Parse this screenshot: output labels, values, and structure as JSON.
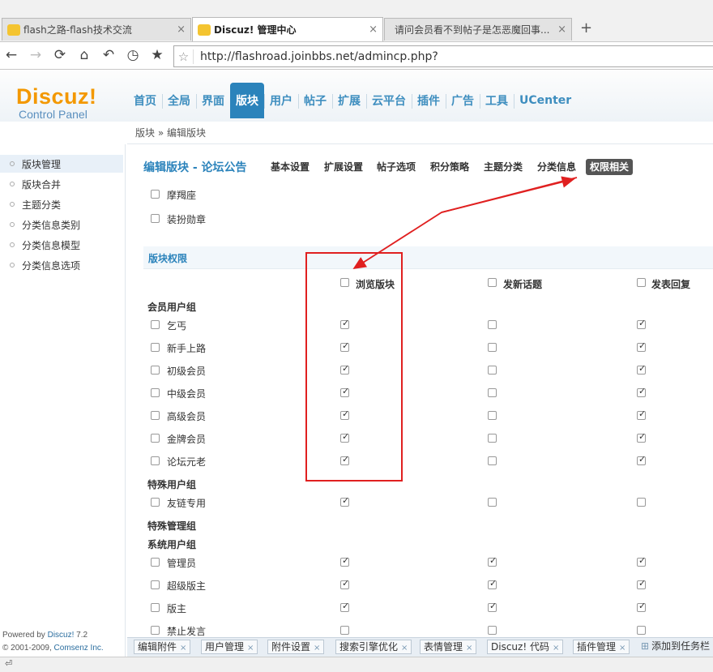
{
  "browser": {
    "tabs": [
      {
        "title": "flash之路-flash技术交流",
        "close": "×"
      },
      {
        "title": "Discuz! 管理中心",
        "close": "×"
      },
      {
        "title": "请问会员看不到帖子是怎恶魔回事...",
        "close": "×"
      }
    ],
    "new_tab": "+",
    "url": "http://flashroad.joinbbs.net/admincp.php?",
    "nav_glyphs": {
      "back": "←",
      "forward": "→",
      "reload": "⟳",
      "home": "⌂",
      "undo": "↶",
      "history": "◷",
      "bookmark": "★",
      "url_star": "☆"
    }
  },
  "logo": {
    "brand": "Discuz!",
    "subtitle": "Control Panel"
  },
  "main_nav": [
    "首页",
    "全局",
    "界面",
    "版块",
    "用户",
    "帖子",
    "扩展",
    "云平台",
    "插件",
    "广告",
    "工具",
    "UCenter"
  ],
  "main_nav_active": 3,
  "breadcrumb": "版块 » 编辑版块",
  "sidebar": {
    "items": [
      "版块管理",
      "版块合并",
      "主题分类",
      "分类信息类别",
      "分类信息模型",
      "分类信息选项"
    ],
    "active": 0,
    "powered_line1_pre": "Powered by ",
    "powered_line1_brand": "Discuz!",
    "powered_line1_ver": " 7.2",
    "powered_line2_pre": "© 2001-2009, ",
    "powered_line2_brand": "Comsenz Inc."
  },
  "content": {
    "page_title": "编辑版块 - 论坛公告",
    "subtabs": [
      "基本设置",
      "扩展设置",
      "帖子选项",
      "积分策略",
      "主题分类",
      "分类信息",
      "权限相关"
    ],
    "subtab_active": 6,
    "top_options": [
      {
        "label": "摩羯座",
        "checked": false
      },
      {
        "label": "装扮勋章",
        "checked": false
      }
    ],
    "section_title": "版块权限",
    "columns": [
      {
        "label": "浏览版块",
        "checked": false
      },
      {
        "label": "发新话题",
        "checked": false
      },
      {
        "label": "发表回复",
        "checked": false
      }
    ],
    "groups": [
      {
        "name": "会员用户组",
        "rows": [
          {
            "label": "乞丐",
            "row_checked": false,
            "values": [
              true,
              false,
              true
            ]
          },
          {
            "label": "新手上路",
            "row_checked": false,
            "values": [
              true,
              false,
              true
            ]
          },
          {
            "label": "初级会员",
            "row_checked": false,
            "values": [
              true,
              false,
              true
            ]
          },
          {
            "label": "中级会员",
            "row_checked": false,
            "values": [
              true,
              false,
              true
            ]
          },
          {
            "label": "高级会员",
            "row_checked": false,
            "values": [
              true,
              false,
              true
            ]
          },
          {
            "label": "金牌会员",
            "row_checked": false,
            "values": [
              true,
              false,
              true
            ]
          },
          {
            "label": "论坛元老",
            "row_checked": false,
            "values": [
              true,
              false,
              true
            ]
          }
        ]
      },
      {
        "name": "特殊用户组",
        "rows": [
          {
            "label": "友链专用",
            "row_checked": false,
            "values": [
              true,
              false,
              false
            ]
          }
        ]
      },
      {
        "name": "特殊管理组",
        "rows": []
      },
      {
        "name": "系统用户组",
        "rows": [
          {
            "label": "管理员",
            "row_checked": false,
            "values": [
              true,
              true,
              true
            ]
          },
          {
            "label": "超级版主",
            "row_checked": false,
            "values": [
              true,
              true,
              true
            ]
          },
          {
            "label": "版主",
            "row_checked": false,
            "values": [
              true,
              true,
              true
            ]
          },
          {
            "label": "禁止发言",
            "row_checked": false,
            "values": [
              false,
              false,
              false
            ]
          }
        ]
      }
    ]
  },
  "bottom_tabs": [
    {
      "label": "编辑附件",
      "close": "×"
    },
    {
      "label": "用户管理",
      "close": "×"
    },
    {
      "label": "附件设置",
      "close": "×"
    },
    {
      "label": "搜索引擎优化",
      "close": "×"
    },
    {
      "label": "表情管理",
      "close": "×"
    },
    {
      "label": "Discuz! 代码",
      "close": "×"
    },
    {
      "label": "插件管理",
      "close": "×"
    }
  ],
  "add_to_taskbar": "添加到任务栏",
  "add_to_taskbar_icon": "⊞",
  "status_icon": "⏎",
  "colors": {
    "accent": "#2b83bb",
    "brand_orange": "#f39800",
    "annotation_red": "#e02020"
  }
}
